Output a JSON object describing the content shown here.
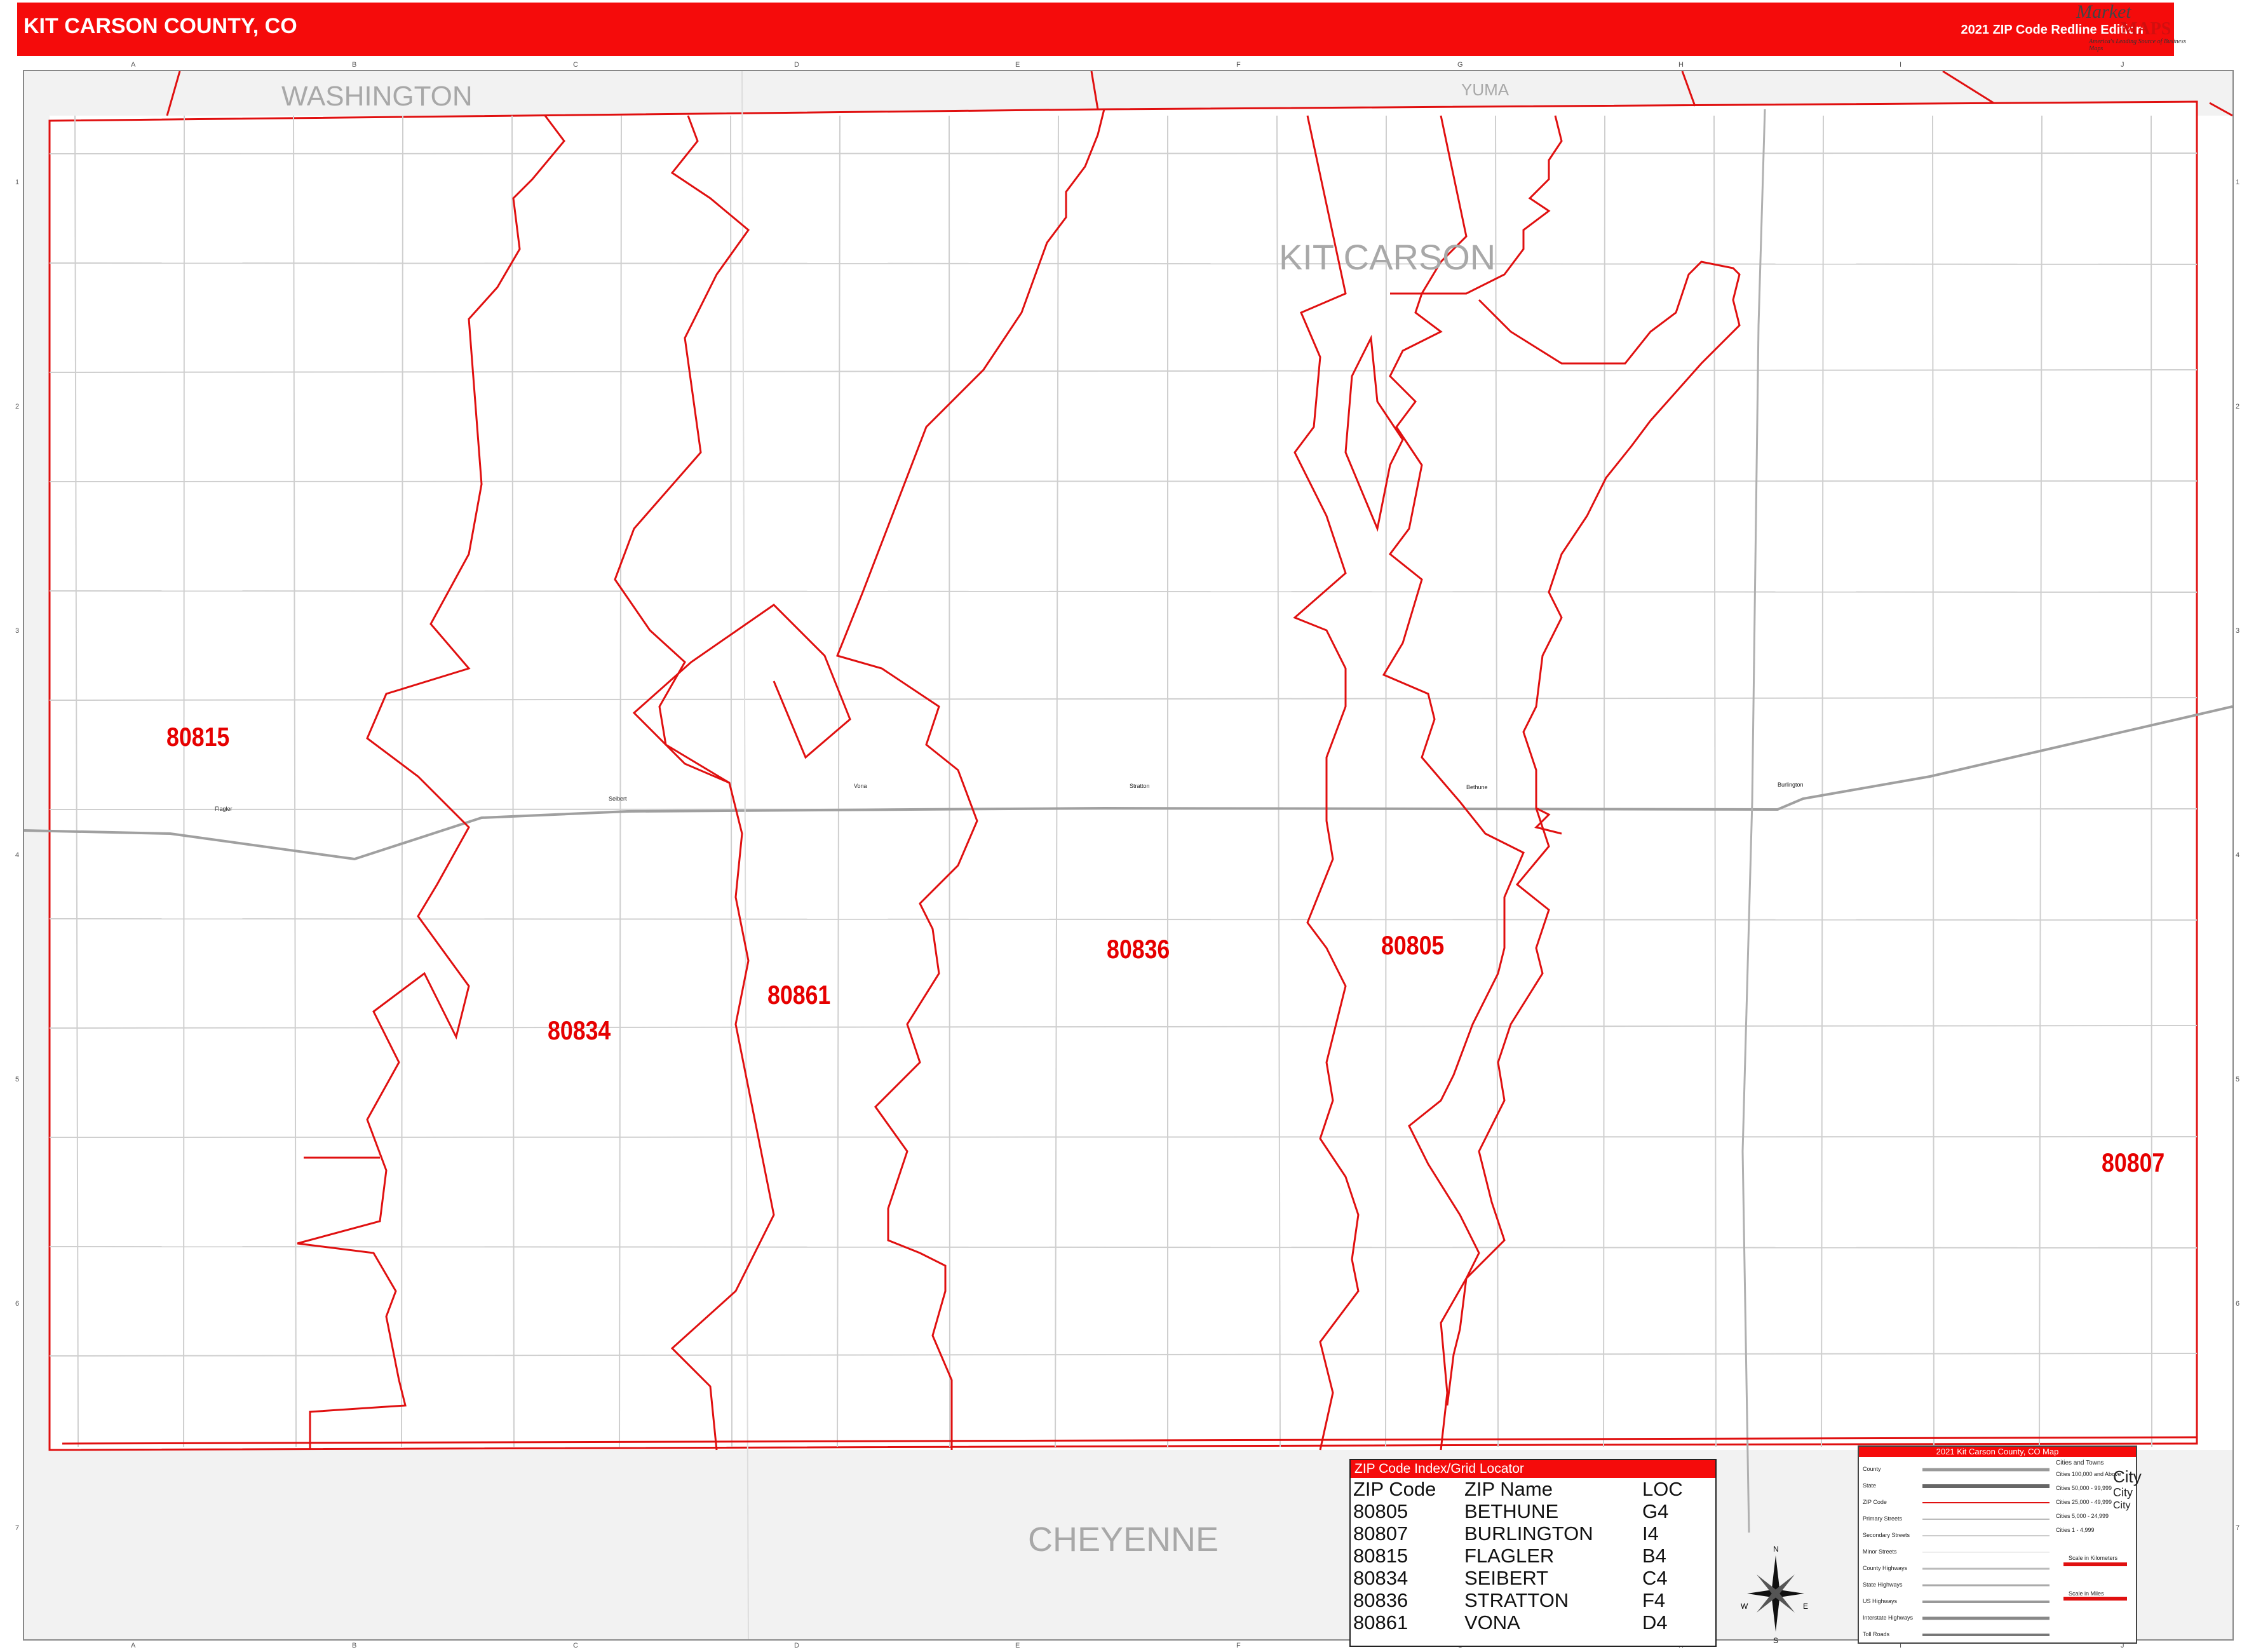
{
  "header": {
    "title": "KIT CARSON COUNTY, CO",
    "edition": "2021 ZIP Code Redline Edition"
  },
  "logo": {
    "brand": "Market",
    "maps": "MAPS",
    "tagline": "America's Leading Source of Business Maps",
    "slogan": "On Target. On Time."
  },
  "grid": {
    "columns": [
      "A",
      "B",
      "C",
      "D",
      "E",
      "F",
      "G",
      "H",
      "I",
      "J"
    ],
    "rows": [
      "1",
      "2",
      "3",
      "4",
      "5",
      "6",
      "7"
    ]
  },
  "regions": {
    "washington": "WASHINGTON",
    "yuma": "YUMA",
    "kit_carson": "KIT CARSON",
    "cheyenne": "CHEYENNE"
  },
  "zip_labels": [
    "80815",
    "80834",
    "80861",
    "80836",
    "80805",
    "80807"
  ],
  "towns": [
    "Flagler",
    "Seibert",
    "Vona",
    "Stratton",
    "Bethune",
    "Burlington"
  ],
  "index": {
    "title": "ZIP Code Index/Grid Locator",
    "headers": [
      "ZIP Code",
      "ZIP Name",
      "LOC"
    ],
    "rows": [
      [
        "80805",
        "BETHUNE",
        "G4"
      ],
      [
        "80807",
        "BURLINGTON",
        "I4"
      ],
      [
        "80815",
        "FLAGLER",
        "B4"
      ],
      [
        "80834",
        "SEIBERT",
        "C4"
      ],
      [
        "80836",
        "STRATTON",
        "F4"
      ],
      [
        "80861",
        "VONA",
        "D4"
      ]
    ]
  },
  "legend": {
    "title": "2021 Kit Carson County, CO Map",
    "cities_title": "Cities and Towns",
    "items": [
      "County",
      "State",
      "ZIP Code",
      "Primary Streets",
      "Secondary Streets",
      "Minor Streets",
      "County Highways",
      "State Highways",
      "US Highways",
      "Interstate Highways",
      "Toll Roads"
    ],
    "cities": [
      "Cities 100,000 and Above",
      "Cities 50,000 - 99,999",
      "Cities 25,000 - 49,999",
      "Cities 5,000 - 24,999",
      "Cities 1 - 4,999"
    ],
    "city_sample": "City",
    "scale_km": "Scale in Kilometers",
    "scale_mi": "Scale in Miles"
  },
  "compass": {
    "n": "N",
    "s": "S",
    "e": "E",
    "w": "W"
  },
  "colors": {
    "red": "#f50b0b",
    "zipline": "#e01010",
    "road": "#c8c8c8",
    "outside": "#f2f2f2"
  }
}
